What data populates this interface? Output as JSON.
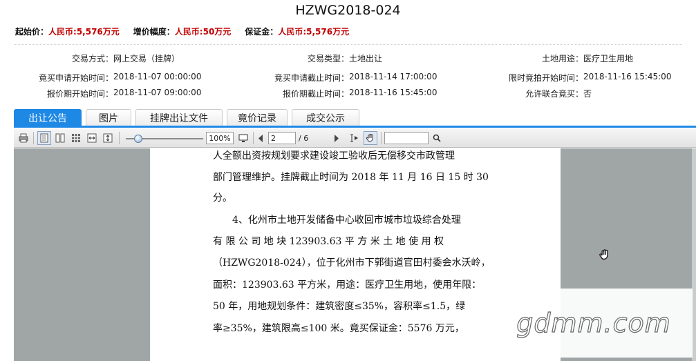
{
  "title": "HZWG2018-024",
  "price_bar": {
    "start_price_label": "起始价：",
    "start_price_value": "人民币:5,576万元",
    "increment_label": "增价幅度：",
    "increment_value": "人民币:50万元",
    "deposit_label": "保证金：",
    "deposit_value": "人民币:5,576万元"
  },
  "info": {
    "trade_method_label": "交易方式：",
    "trade_method_value": "网上交易（挂牌）",
    "trade_type_label": "交易类型：",
    "trade_type_value": "土地出让",
    "land_use_label": "土地用途：",
    "land_use_value": "医疗卫生用地",
    "apply_start_label": "竟买申请开始时间：",
    "apply_start_value": "2018-11-07 00:00:00",
    "apply_end_label": "竟买申请截止时间：",
    "apply_end_value": "2018-11-14 17:00:00",
    "timed_bid_label": "限时竟拍开始时间：",
    "timed_bid_value": "2018-11-16 15:45:00",
    "quote_start_label": "报价期开始时间：",
    "quote_start_value": "2018-11-07 09:00:00",
    "quote_end_label": "报价期截止时间：",
    "quote_end_value": "2018-11-16 15:45:00",
    "joint_label": "允许联合竟买：",
    "joint_value": "否"
  },
  "tabs": [
    {
      "label": "出让公告"
    },
    {
      "label": "图片"
    },
    {
      "label": "挂牌出让文件"
    },
    {
      "label": "竟价记录"
    },
    {
      "label": "成交公示"
    }
  ],
  "toolbar": {
    "zoom": "100%",
    "page_current": "2",
    "page_total": "/ 6"
  },
  "document": {
    "lines": [
      "人全额出资按规划要求建设竣工验收后无偿移交市政管理",
      "部门管理维护。挂牌截止时间为 2018 年 11 月 16 日 15 时 30",
      "分。",
      "4、化州市土地开发储备中心收回市城市垃圾综合处理",
      "有 限 公 司 地 块  123903.63  平 方 米 土 地 使 用 权",
      "（HZWG2018-024），位于化州市下郭街道官田村委会水沃岭，",
      "面积：123903.63 平方米，用途：医疗卫生用地，使用年限：",
      "50 年，用地规划条件：建筑密度≤35%，容积率≤1.5，绿",
      "率≥35%，建筑限高≤100 米。竟买保证金：5576 万元，"
    ]
  },
  "watermark": "gdmm.com",
  "colors": {
    "accent": "#1e88e5",
    "price_red": "#c00000",
    "viewer_bg": "#a0a6a6"
  }
}
